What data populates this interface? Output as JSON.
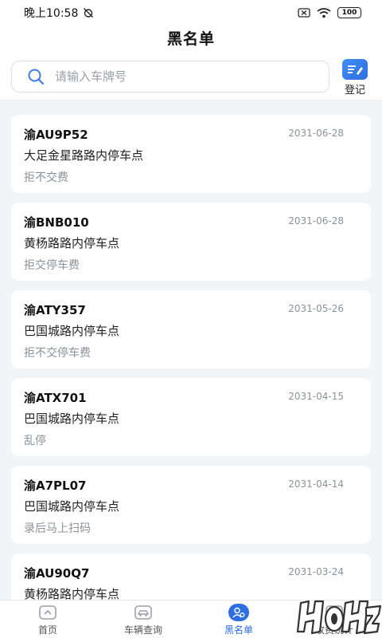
{
  "status_bar": {
    "time": "晚上10:58",
    "battery": "100"
  },
  "header": {
    "title": "黑名单",
    "search_placeholder": "请输入车牌号",
    "register_label": "登记"
  },
  "blacklist": [
    {
      "plate": "渝AU9P52",
      "date": "2031-06-28",
      "location": "大足金星路路内停车点",
      "reason": "拒不交费"
    },
    {
      "plate": "渝BNB010",
      "date": "2031-06-28",
      "location": "黄杨路路内停车点",
      "reason": "拒交停车费"
    },
    {
      "plate": "渝ATY357",
      "date": "2031-05-26",
      "location": "巴国城路内停车点",
      "reason": "拒不交停车费"
    },
    {
      "plate": "渝ATX701",
      "date": "2031-04-15",
      "location": "巴国城路内停车点",
      "reason": "乱停"
    },
    {
      "plate": "渝A7PL07",
      "date": "2031-04-14",
      "location": "巴国城路内停车点",
      "reason": "录后马上扫码"
    },
    {
      "plate": "渝AU90Q7",
      "date": "2031-03-24",
      "location": "黄杨路路内停车点",
      "reason": ""
    }
  ],
  "bottom_nav": {
    "items": [
      {
        "label": "首页",
        "icon": "home-icon"
      },
      {
        "label": "车辆查询",
        "icon": "car-icon"
      },
      {
        "label": "黑名单",
        "icon": "blacklist-user-icon",
        "active": true
      },
      {
        "label": "收费统计",
        "icon": "stats-icon"
      }
    ]
  },
  "colors": {
    "accent": "#2d6ee0",
    "background": "#f3f4f6",
    "muted_text": "#8d9198"
  }
}
